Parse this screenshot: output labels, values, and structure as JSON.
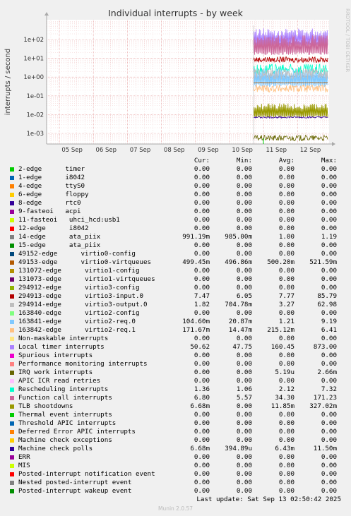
{
  "chart_data": {
    "type": "line",
    "title": "Individual interrupts - by week",
    "ylabel": "interrupts / second",
    "yscale": "log",
    "ylim": [
      0.0005,
      400
    ],
    "yticks": [
      "1e-03",
      "1e-02",
      "1e-01",
      "1e+00",
      "1e+01",
      "1e+02"
    ],
    "xticks": [
      "05 Sep",
      "06 Sep",
      "07 Sep",
      "08 Sep",
      "09 Sep",
      "10 Sep",
      "11 Sep",
      "12 Sep"
    ],
    "watermark": "RRDTOOL / TOBI OETIKER",
    "columns": [
      "Cur:",
      "Min:",
      "Avg:",
      "Max:"
    ],
    "series": [
      {
        "name": "2-edge      timer",
        "color": "#00cc00",
        "cur": "0.00",
        "min": "0.00",
        "avg": "0.00",
        "max": "0.00"
      },
      {
        "name": "1-edge      i8042",
        "color": "#0066b3",
        "cur": "0.00",
        "min": "0.00",
        "avg": "0.00",
        "max": "0.00"
      },
      {
        "name": "4-edge      ttyS0",
        "color": "#ff8000",
        "cur": "0.00",
        "min": "0.00",
        "avg": "0.00",
        "max": "0.00"
      },
      {
        "name": "6-edge      floppy",
        "color": "#ffcc00",
        "cur": "0.00",
        "min": "0.00",
        "avg": "0.00",
        "max": "0.00"
      },
      {
        "name": "8-edge      rtc0",
        "color": "#330099",
        "cur": "0.00",
        "min": "0.00",
        "avg": "0.00",
        "max": "0.00"
      },
      {
        "name": "9-fasteoi   acpi",
        "color": "#990099",
        "cur": "0.00",
        "min": "0.00",
        "avg": "0.00",
        "max": "0.00"
      },
      {
        "name": "11-fasteoi   uhci_hcd:usb1",
        "color": "#ccff00",
        "cur": "0.00",
        "min": "0.00",
        "avg": "0.00",
        "max": "0.00"
      },
      {
        "name": "12-edge      i8042",
        "color": "#ff0000",
        "cur": "0.00",
        "min": "0.00",
        "avg": "0.00",
        "max": "0.00"
      },
      {
        "name": "14-edge      ata_piix",
        "color": "#808080",
        "cur": "991.19m",
        "min": "985.00m",
        "avg": "1.00",
        "max": "1.19"
      },
      {
        "name": "15-edge      ata_piix",
        "color": "#008f00",
        "cur": "0.00",
        "min": "0.00",
        "avg": "0.00",
        "max": "0.00"
      },
      {
        "name": "49152-edge      virtio0-config",
        "color": "#00487d",
        "cur": "0.00",
        "min": "0.00",
        "avg": "0.00",
        "max": "0.00"
      },
      {
        "name": "49153-edge      virtio0-virtqueues",
        "color": "#b35a00",
        "cur": "499.45m",
        "min": "496.86m",
        "avg": "500.20m",
        "max": "521.59m"
      },
      {
        "name": "131072-edge      virtio1-config",
        "color": "#b38f00",
        "cur": "0.00",
        "min": "0.00",
        "avg": "0.00",
        "max": "0.00"
      },
      {
        "name": "131073-edge      virtio1-virtqueues",
        "color": "#6b006b",
        "cur": "0.00",
        "min": "0.00",
        "avg": "0.00",
        "max": "0.00"
      },
      {
        "name": "294912-edge      virtio3-config",
        "color": "#8fb300",
        "cur": "0.00",
        "min": "0.00",
        "avg": "0.00",
        "max": "0.00"
      },
      {
        "name": "294913-edge      virtio3-input.0",
        "color": "#b30000",
        "cur": "7.47",
        "min": "6.05",
        "avg": "7.77",
        "max": "85.79"
      },
      {
        "name": "294914-edge      virtio3-output.0",
        "color": "#bebebe",
        "cur": "1.82",
        "min": "704.78m",
        "avg": "3.27",
        "max": "62.98"
      },
      {
        "name": "163840-edge      virtio2-config",
        "color": "#80ff80",
        "cur": "0.00",
        "min": "0.00",
        "avg": "0.00",
        "max": "0.00"
      },
      {
        "name": "163841-edge      virtio2-req.0",
        "color": "#80c9ff",
        "cur": "104.60m",
        "min": "20.87m",
        "avg": "1.21",
        "max": "9.19"
      },
      {
        "name": "163842-edge      virtio2-req.1",
        "color": "#ffc080",
        "cur": "171.67m",
        "min": "14.47m",
        "avg": "215.12m",
        "max": "6.41"
      },
      {
        "name": "Non-maskable interrupts",
        "color": "#ffe680",
        "cur": "0.00",
        "min": "0.00",
        "avg": "0.00",
        "max": "0.00"
      },
      {
        "name": "Local timer interrupts",
        "color": "#aa80ff",
        "cur": "50.62",
        "min": "47.75",
        "avg": "160.45",
        "max": "873.00"
      },
      {
        "name": "Spurious interrupts",
        "color": "#ee00cc",
        "cur": "0.00",
        "min": "0.00",
        "avg": "0.00",
        "max": "0.00"
      },
      {
        "name": "Performance monitoring interrupts",
        "color": "#ff8080",
        "cur": "0.00",
        "min": "0.00",
        "avg": "0.00",
        "max": "0.00"
      },
      {
        "name": "IRQ work interrupts",
        "color": "#666600",
        "cur": "0.00",
        "min": "0.00",
        "avg": "5.19u",
        "max": "2.66m"
      },
      {
        "name": "APIC ICR read retries",
        "color": "#ffbfff",
        "cur": "0.00",
        "min": "0.00",
        "avg": "0.00",
        "max": "0.00"
      },
      {
        "name": "Rescheduling interrupts",
        "color": "#00ffcc",
        "cur": "1.36",
        "min": "1.06",
        "avg": "2.12",
        "max": "7.32"
      },
      {
        "name": "Function call interrupts",
        "color": "#cc6699",
        "cur": "6.80",
        "min": "5.57",
        "avg": "34.30",
        "max": "171.23"
      },
      {
        "name": "TLB shootdowns",
        "color": "#999900",
        "cur": "6.68m",
        "min": "0.00",
        "avg": "11.85m",
        "max": "327.02m"
      },
      {
        "name": "Thermal event interrupts",
        "color": "#00cc00",
        "cur": "0.00",
        "min": "0.00",
        "avg": "0.00",
        "max": "0.00"
      },
      {
        "name": "Threshold APIC interrupts",
        "color": "#0066b3",
        "cur": "0.00",
        "min": "0.00",
        "avg": "0.00",
        "max": "0.00"
      },
      {
        "name": "Deferred Error APIC interrupts",
        "color": "#ff8000",
        "cur": "0.00",
        "min": "0.00",
        "avg": "0.00",
        "max": "0.00"
      },
      {
        "name": "Machine check exceptions",
        "color": "#ffcc00",
        "cur": "0.00",
        "min": "0.00",
        "avg": "0.00",
        "max": "0.00"
      },
      {
        "name": "Machine check polls",
        "color": "#330099",
        "cur": "6.68m",
        "min": "394.89u",
        "avg": "6.43m",
        "max": "11.50m"
      },
      {
        "name": "ERR",
        "color": "#990099",
        "cur": "0.00",
        "min": "0.00",
        "avg": "0.00",
        "max": "0.00"
      },
      {
        "name": "MIS",
        "color": "#ccff00",
        "cur": "0.00",
        "min": "0.00",
        "avg": "0.00",
        "max": "0.00"
      },
      {
        "name": "Posted-interrupt notification event",
        "color": "#ff0000",
        "cur": "0.00",
        "min": "0.00",
        "avg": "0.00",
        "max": "0.00"
      },
      {
        "name": "Nested posted-interrupt event",
        "color": "#808080",
        "cur": "0.00",
        "min": "0.00",
        "avg": "0.00",
        "max": "0.00"
      },
      {
        "name": "Posted-interrupt wakeup event",
        "color": "#008f00",
        "cur": "0.00",
        "min": "0.00",
        "avg": "0.00",
        "max": "0.00"
      }
    ],
    "plotted": [
      {
        "series": "Local timer interrupts",
        "min": 40,
        "max": 400,
        "color": "#aa80ff"
      },
      {
        "series": "Function call interrupts",
        "min": 15,
        "max": 180,
        "color": "#cc6699"
      },
      {
        "series": "294913-edge      virtio3-input.0",
        "min": 6,
        "max": 12,
        "color": "#b30000"
      },
      {
        "series": "Rescheduling interrupts",
        "min": 1.2,
        "max": 5,
        "color": "#00ffcc"
      },
      {
        "series": "14-edge      ata_piix",
        "min": 0.9,
        "max": 1.2,
        "color": "#808080"
      },
      {
        "series": "163841-edge      virtio2-req.0",
        "min": 0.3,
        "max": 3,
        "color": "#80c9ff"
      },
      {
        "series": "294914-edge      virtio3-output.0",
        "min": 0.7,
        "max": 3,
        "color": "#bebebe"
      },
      {
        "series": "49153-edge      virtio0-virtqueues",
        "min": 0.49,
        "max": 0.52,
        "color": "#b35a00"
      },
      {
        "series": "163842-edge      virtio2-req.1",
        "min": 0.15,
        "max": 0.4,
        "color": "#ffc080"
      },
      {
        "series": "TLB shootdowns",
        "min": 0.007,
        "max": 0.04,
        "color": "#999900"
      },
      {
        "series": "Machine check polls",
        "min": 0.0065,
        "max": 0.008,
        "color": "#330099"
      },
      {
        "series": "IRQ work interrupts",
        "min": 0.0004,
        "max": 0.0008,
        "color": "#666600"
      }
    ]
  },
  "last_update": "Last update: Sat Sep 13 02:50:42 2025",
  "footer": "Munin 2.0.57"
}
